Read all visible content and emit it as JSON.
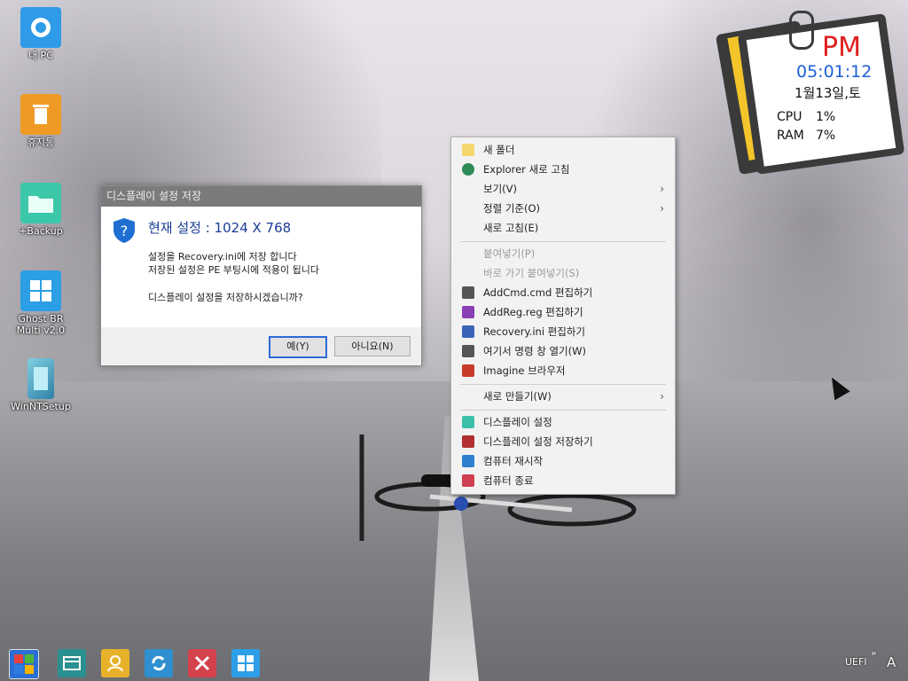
{
  "desktop_icons": [
    {
      "label": "내 PC",
      "icon": "this-pc-icon",
      "color": "#2f9be8"
    },
    {
      "label": "휴지통",
      "icon": "recycle-bin-icon",
      "color": "#f09a26"
    },
    {
      "label": "+Backup",
      "icon": "folder-icon",
      "color": "#3cc7a9"
    },
    {
      "label": "Ghost BR Multi v2.0",
      "icon": "windows-icon",
      "color": "#2b9ee5"
    },
    {
      "label": "WinNTSetup",
      "icon": "setup-icon",
      "color": "#4aa0c0"
    }
  ],
  "dialog": {
    "title": "디스플레이 설정 저장",
    "heading": "현재 설정 : 1024 X 768",
    "line1": "설정을 Recovery.ini에 저장 합니다",
    "line2": "저장된 설정은 PE 부팅시에 적용이 됩니다",
    "question": "디스플레이 설정을 저장하시겠습니까?",
    "yes_label": "예(Y)",
    "no_label": "아니요(N)"
  },
  "context_menu": {
    "items": [
      {
        "label": "새 폴더",
        "icon": "folder-icon",
        "color": "#f5d76e",
        "disabled": false,
        "submenu": false
      },
      {
        "label": "Explorer 새로 고침",
        "icon": "refresh-icon",
        "color": "#2e8b57",
        "disabled": false,
        "submenu": false
      },
      {
        "label": "보기(V)",
        "icon": "",
        "disabled": false,
        "submenu": true
      },
      {
        "label": "정렬 기준(O)",
        "icon": "",
        "disabled": false,
        "submenu": true
      },
      {
        "label": "새로 고침(E)",
        "icon": "",
        "disabled": false,
        "submenu": false
      },
      {
        "label": "붙여넣기(P)",
        "icon": "",
        "disabled": true,
        "submenu": false
      },
      {
        "label": "바로 가기 붙여넣기(S)",
        "icon": "",
        "disabled": true,
        "submenu": false
      },
      {
        "label": "AddCmd.cmd 편집하기",
        "icon": "cmd-icon",
        "color": "#555555",
        "disabled": false,
        "submenu": false
      },
      {
        "label": "AddReg.reg 편집하기",
        "icon": "registry-icon",
        "color": "#8a3fb4",
        "disabled": false,
        "submenu": false
      },
      {
        "label": "Recovery.ini 편집하기",
        "icon": "notepad-icon",
        "color": "#3b64b8",
        "disabled": false,
        "submenu": false
      },
      {
        "label": "여기서 명령 창 열기(W)",
        "icon": "cmd-icon",
        "color": "#555555",
        "disabled": false,
        "submenu": false
      },
      {
        "label": "Imagine 브라우저",
        "icon": "imagine-icon",
        "color": "#c83a2a",
        "disabled": false,
        "submenu": false
      },
      {
        "label": "새로 만들기(W)",
        "icon": "",
        "disabled": false,
        "submenu": true
      },
      {
        "label": "디스플레이 설정",
        "icon": "display-icon",
        "color": "#3cc0a8",
        "disabled": false,
        "submenu": false
      },
      {
        "label": "디스플레이 설정 저장하기",
        "icon": "display-save-icon",
        "color": "#b03030",
        "disabled": false,
        "submenu": false
      },
      {
        "label": "컴퓨터 재시작",
        "icon": "restart-icon",
        "color": "#2f7fd0",
        "disabled": false,
        "submenu": false
      },
      {
        "label": "컴퓨터 종료",
        "icon": "shutdown-icon",
        "color": "#d04050",
        "disabled": false,
        "submenu": false
      }
    ]
  },
  "clock": {
    "ampm": "PM",
    "time": "05:01:12",
    "date": "1월13일,토",
    "cpu_label": "CPU",
    "cpu_value": "1%",
    "ram_label": "RAM",
    "ram_value": "7%"
  },
  "taskbar": {
    "buttons": [
      {
        "icon": "start-icon",
        "color": "#2a6fd6"
      },
      {
        "icon": "window-icon",
        "color": "#2a8f8f"
      },
      {
        "icon": "user-icon",
        "color": "#e7b22a"
      },
      {
        "icon": "restart-icon",
        "color": "#2f8fd0"
      },
      {
        "icon": "close-x-icon",
        "color": "#d4424e"
      },
      {
        "icon": "windows-icon",
        "color": "#2d9ee8"
      }
    ],
    "tray_text": "UEFI",
    "ime_text": "A"
  }
}
